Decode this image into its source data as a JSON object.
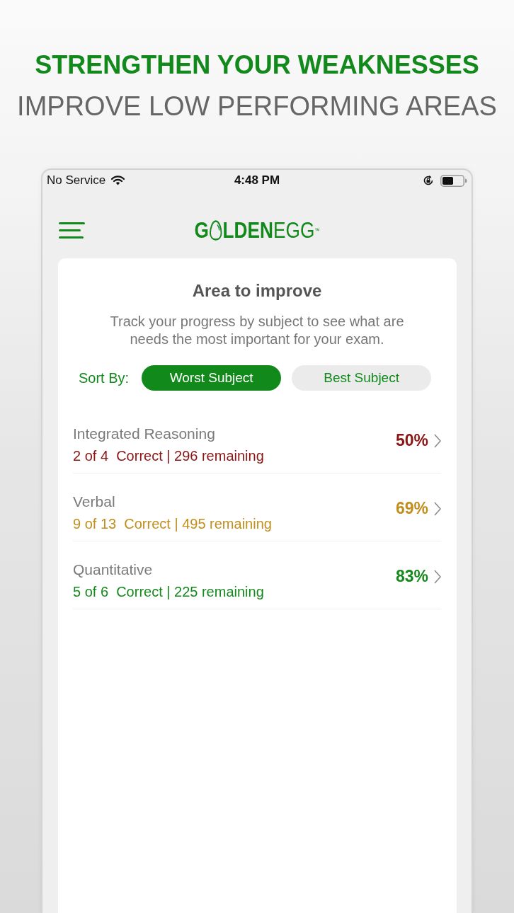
{
  "headline": {
    "title": "STRENGTHEN YOUR WEAKNESSES",
    "subtitle": "IMPROVE LOW PERFORMING AREAS"
  },
  "status_bar": {
    "carrier": "No Service",
    "time": "4:48 PM"
  },
  "nav": {
    "logo": {
      "parts": [
        {
          "kind": "bold",
          "text": "G"
        },
        {
          "kind": "egg"
        },
        {
          "kind": "bold",
          "text": "LDEN"
        },
        {
          "kind": "light",
          "text": "EGG"
        },
        {
          "kind": "mark",
          "text": "™"
        }
      ]
    }
  },
  "card": {
    "title": "Area to improve",
    "description": "Track your progress by subject to see what are needs the most important for your exam.",
    "sort": {
      "label": "Sort By:",
      "options": [
        {
          "label": "Worst Subject",
          "selected": true
        },
        {
          "label": "Best Subject",
          "selected": false
        }
      ]
    },
    "subjects": [
      {
        "name": "Integrated Reasoning",
        "detail": "2 of 4  Correct | 296 remaining",
        "percent": "50%",
        "color": "#8b1414"
      },
      {
        "name": "Verbal",
        "detail": "9 of 13  Correct | 495 remaining",
        "percent": "69%",
        "color": "#c28e1c"
      },
      {
        "name": "Quantitative",
        "detail": "5 of 6  Correct | 225 remaining",
        "percent": "83%",
        "color": "#15891c"
      }
    ]
  }
}
